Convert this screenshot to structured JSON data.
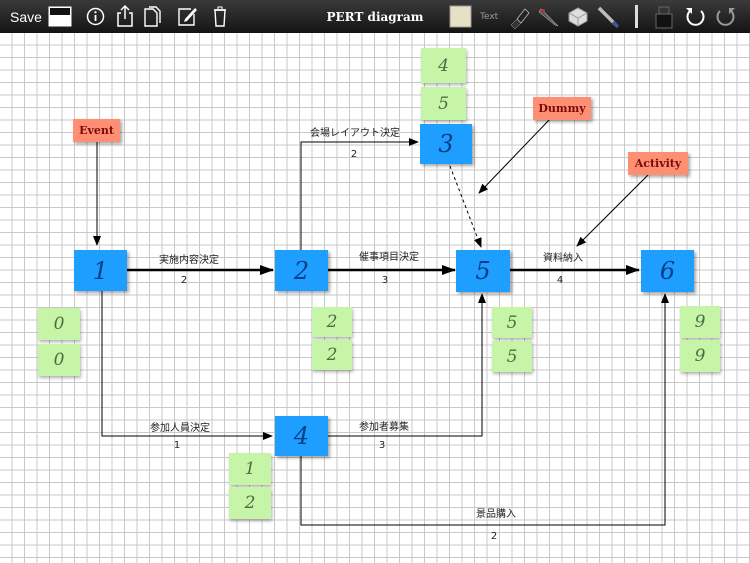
{
  "toolbar": {
    "save_label": "Save",
    "title": "PERT diagram",
    "text_tool_label": "Text",
    "icons": [
      "page-color-icon",
      "info-icon",
      "share-icon",
      "duplicate-icon",
      "edit-icon",
      "trash-icon",
      "sticky-note-icon",
      "marker-icon",
      "pen-icon",
      "eraser-icon",
      "pencil-icon",
      "line-width-icon",
      "ink-bottle-icon",
      "undo-icon",
      "redo-icon"
    ]
  },
  "nodes": [
    {
      "id": "1",
      "label": "1"
    },
    {
      "id": "2",
      "label": "2"
    },
    {
      "id": "3",
      "label": "3"
    },
    {
      "id": "4",
      "label": "4"
    },
    {
      "id": "5",
      "label": "5"
    },
    {
      "id": "6",
      "label": "6"
    }
  ],
  "notes": {
    "n1_top": "0",
    "n1_bottom": "0",
    "n2_top": "2",
    "n2_bottom": "2",
    "n3_top": "4",
    "n3_bottom": "5",
    "n4_top": "1",
    "n4_bottom": "2",
    "n5_top": "5",
    "n5_bottom": "5",
    "n6_top": "9",
    "n6_bottom": "9"
  },
  "labels": {
    "event": "Event",
    "dummy": "Dummy",
    "activity": "Activity"
  },
  "edges": [
    {
      "from": "1",
      "to": "2",
      "name": "実施内容決定",
      "duration": "2"
    },
    {
      "from": "2",
      "to": "3",
      "name": "会場レイアウト決定",
      "duration": "2"
    },
    {
      "from": "2",
      "to": "5",
      "name": "催事項目決定",
      "duration": "3"
    },
    {
      "from": "5",
      "to": "6",
      "name": "資料納入",
      "duration": "4"
    },
    {
      "from": "1",
      "to": "4",
      "name": "参加人員決定",
      "duration": "1"
    },
    {
      "from": "4",
      "to": "5",
      "name": "参加者募集",
      "duration": "3"
    },
    {
      "from": "4",
      "to": "6",
      "name": "景品購入",
      "duration": "2"
    }
  ],
  "colors": {
    "node": "#1e9eff",
    "note": "#c6f5a8",
    "label": "#ff8f73",
    "toolbar": "#1f1f1f"
  }
}
